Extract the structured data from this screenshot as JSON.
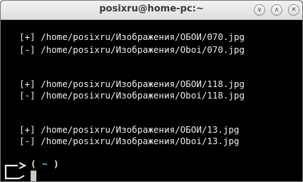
{
  "window": {
    "title": "posixru@home-pc:~",
    "controls": {
      "minimize": "∨",
      "maximize": "∧",
      "close": "✕"
    }
  },
  "terminal": {
    "lines": [
      "[+] /home/posixru/Изображения/ОБОИ/070.jpg",
      "[-] /home/posixru/Изображения/Oboi/070.jpg",
      "[+] /home/posixru/Изображения/ОБОИ/118.jpg",
      "[-] /home/posixru/Изображения/Oboi/118.jpg",
      "[+] /home/posixru/Изображения/ОБОИ/13.jpg",
      "[-] /home/posixru/Изображения/Oboi/13.jpg"
    ],
    "prompt": {
      "open": "(",
      "cwd": "~",
      "close": ")"
    }
  },
  "colors": {
    "background": "#000000",
    "text": "#ececec",
    "prompt_cwd": "#5fd7ff",
    "cursor": "#c8c8c8"
  }
}
